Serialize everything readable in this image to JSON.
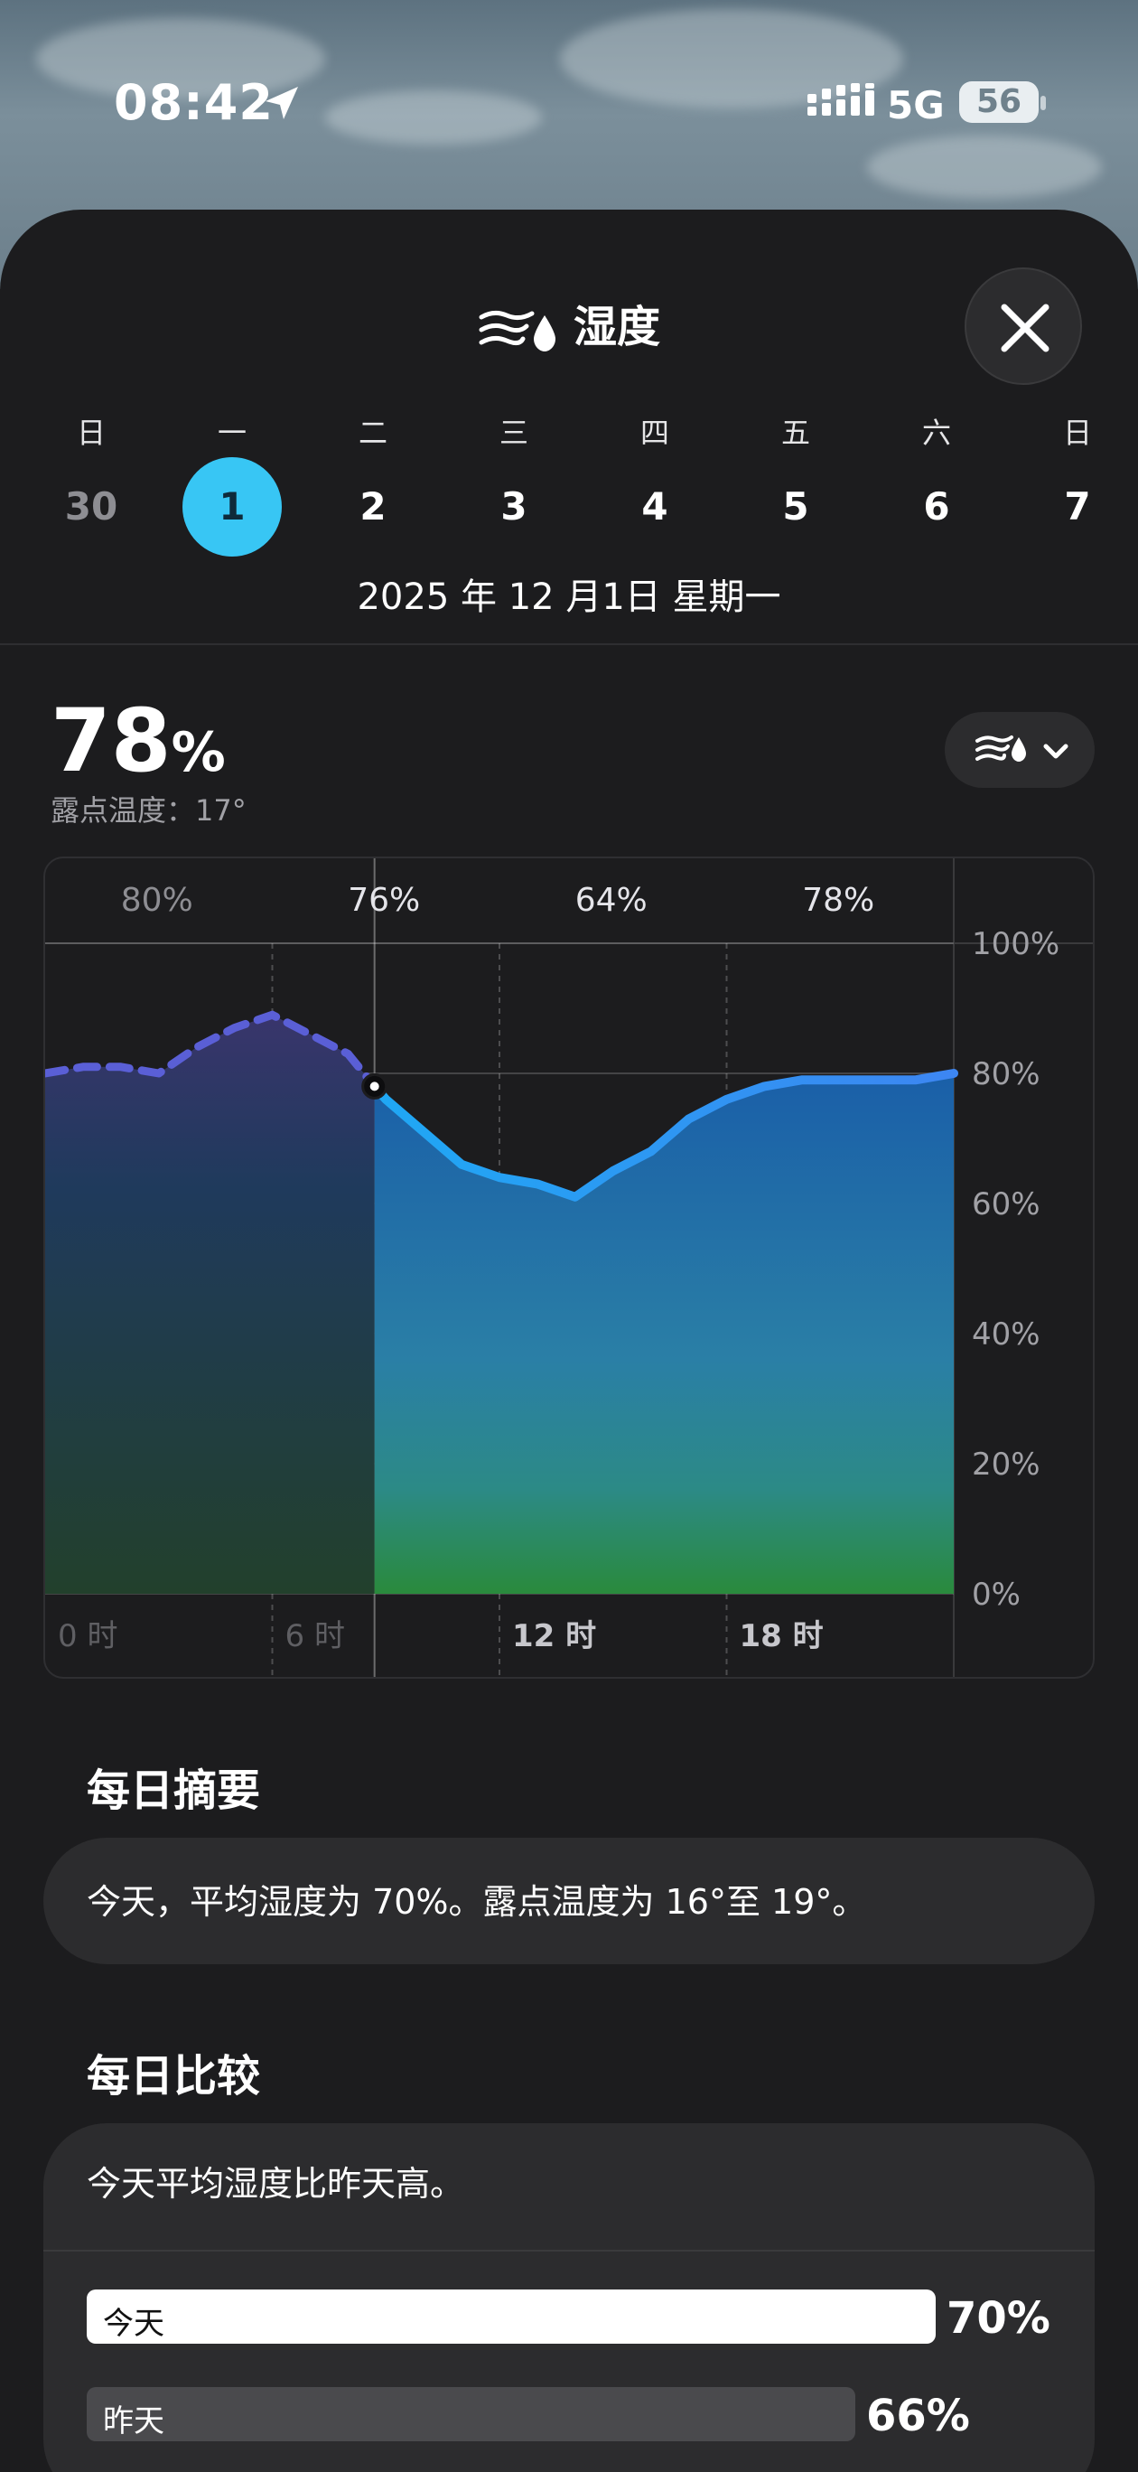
{
  "status_bar": {
    "time": "08:42",
    "network": "5G",
    "battery": "56"
  },
  "header": {
    "title": "湿度",
    "icon": "humidity-icon",
    "close_icon": "close-icon"
  },
  "week": {
    "days": [
      {
        "weekday": "日",
        "date": "30",
        "muted": true
      },
      {
        "weekday": "一",
        "date": "1",
        "selected": true
      },
      {
        "weekday": "二",
        "date": "2"
      },
      {
        "weekday": "三",
        "date": "3"
      },
      {
        "weekday": "四",
        "date": "4"
      },
      {
        "weekday": "五",
        "date": "5"
      },
      {
        "weekday": "六",
        "date": "6"
      },
      {
        "weekday": "日",
        "date": "7"
      }
    ],
    "selected_date_text": "2025 年 12 月1日 星期一"
  },
  "current": {
    "value": "78",
    "unit": "%",
    "dew_point": "露点温度：17°"
  },
  "chart_data": {
    "type": "area",
    "x_ticks": [
      "0 时",
      "6 时",
      "12 时",
      "18 时"
    ],
    "y_ticks": [
      "100%",
      "80%",
      "60%",
      "40%",
      "20%",
      "0%"
    ],
    "ylim": [
      0,
      100
    ],
    "xlim": [
      0,
      24
    ],
    "period_labels": [
      "80%",
      "76%",
      "64%",
      "78%"
    ],
    "current_hour": 8.7,
    "series": [
      {
        "x": [
          0,
          1,
          2,
          3,
          4,
          5,
          6,
          7,
          8,
          8.7,
          9,
          10,
          11,
          12,
          13,
          14,
          15,
          16,
          17,
          18,
          19,
          20,
          21,
          22,
          23,
          24
        ],
        "values": [
          80,
          81,
          81,
          80,
          84,
          87,
          89,
          86,
          83,
          78,
          76,
          71,
          66,
          64,
          63,
          61,
          65,
          68,
          73,
          76,
          78,
          79,
          79,
          79,
          79,
          80
        ]
      }
    ],
    "colors": {
      "past": "#5a5fd6",
      "line": "#1f9bf0"
    }
  },
  "summary": {
    "title": "每日摘要",
    "text": "今天，平均湿度为 70%。露点温度为 16°至 19°。"
  },
  "comparison": {
    "title": "每日比较",
    "text": "今天平均湿度比昨天高。",
    "today": {
      "label": "今天",
      "value": "70%",
      "fraction": 0.7
    },
    "yesterday": {
      "label": "昨天",
      "value": "66%",
      "fraction": 0.66
    }
  }
}
